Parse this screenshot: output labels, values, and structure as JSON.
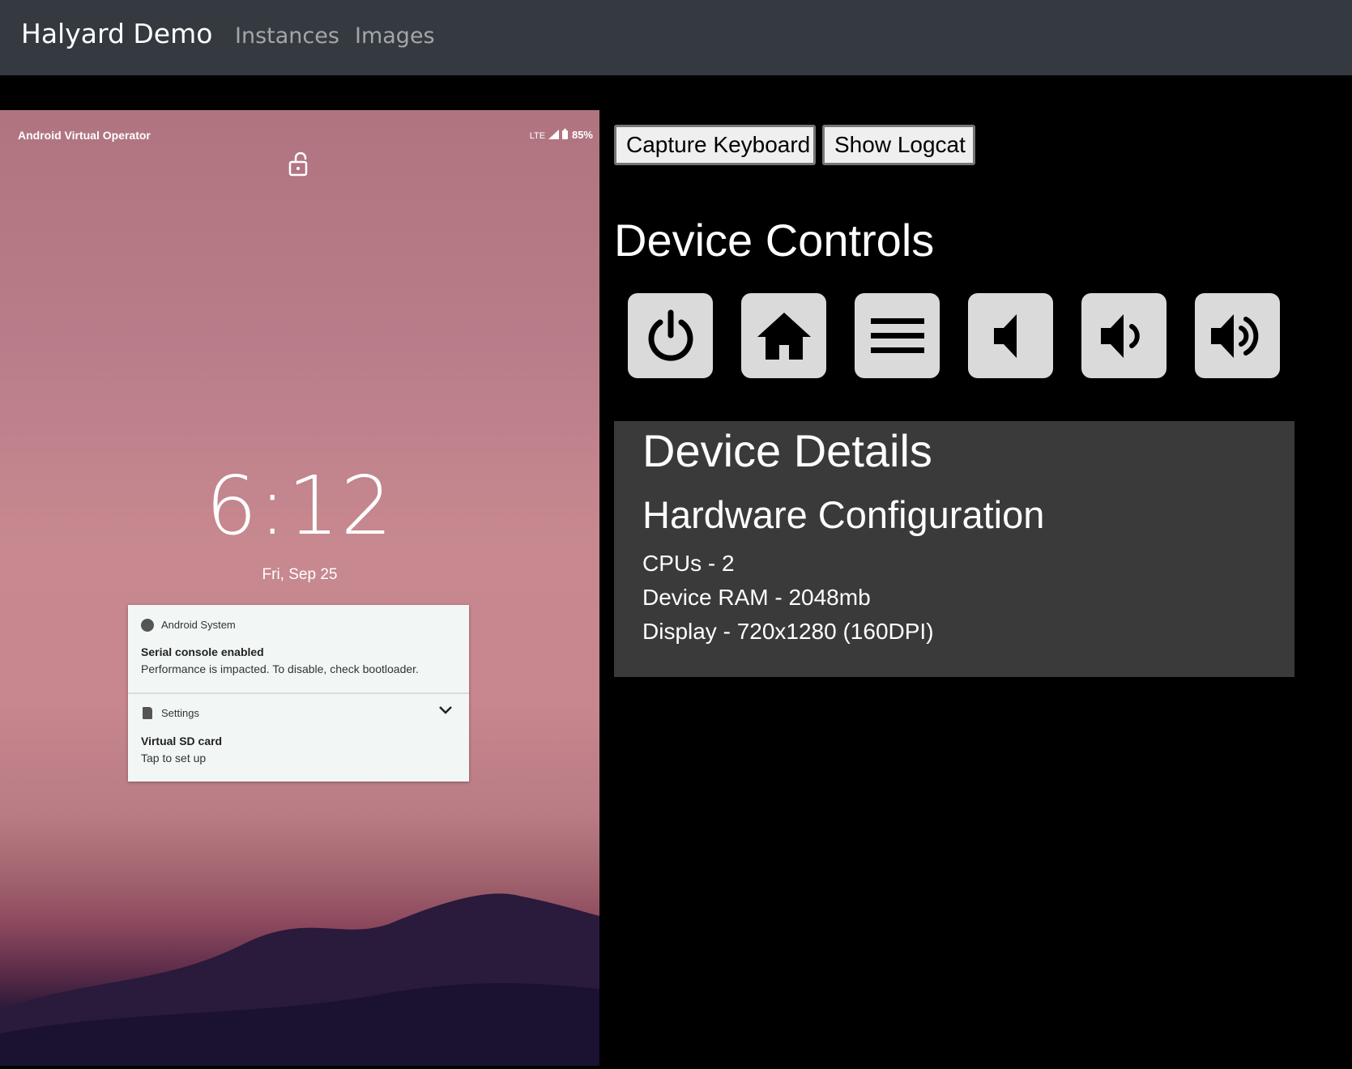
{
  "navbar": {
    "brand": "Halyard Demo",
    "links": [
      "Instances",
      "Images"
    ]
  },
  "device_screen": {
    "operator": "Android Virtual Operator",
    "network": "LTE",
    "battery": "85%",
    "lock_icon": "unlock-icon",
    "clock": "6:12",
    "date": "Fri, Sep 25",
    "notifications": [
      {
        "app": "Android System",
        "title": "Serial console enabled",
        "text": "Performance is impacted. To disable, check bootloader."
      },
      {
        "app": "Settings",
        "title": "Virtual SD card",
        "text": "Tap to set up"
      }
    ]
  },
  "actions": {
    "capture_keyboard": "Capture Keyboard",
    "show_logcat": "Show Logcat"
  },
  "controls": {
    "heading": "Device Controls",
    "buttons": [
      "power-icon",
      "home-icon",
      "menu-icon",
      "volume-mute-icon",
      "volume-down-icon",
      "volume-up-icon"
    ]
  },
  "details": {
    "heading": "Device Details",
    "subheading": "Hardware Configuration",
    "specs": [
      "CPUs - 2",
      "Device RAM - 2048mb",
      "Display - 720x1280 (160DPI)"
    ]
  },
  "colors": {
    "navbar_bg": "#343a40",
    "panel_bg": "#3a3a3a",
    "control_button_bg": "#dadada"
  }
}
